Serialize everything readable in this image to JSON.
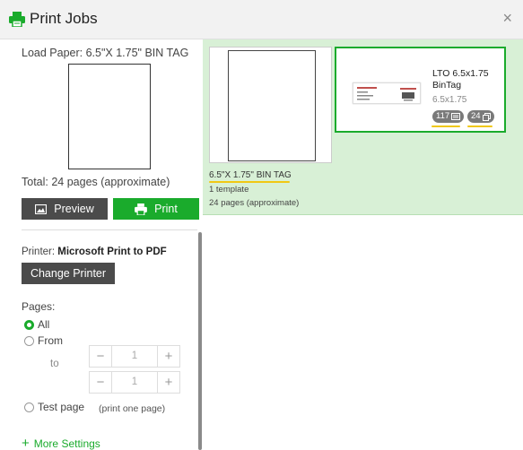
{
  "window": {
    "title": "Print Jobs",
    "close_glyph": "×"
  },
  "left_panel": {
    "load_paper": "Load Paper: 6.5\"X 1.75\" BIN TAG",
    "total": "Total: 24 pages (approximate)",
    "preview_label": "Preview",
    "print_label": "Print",
    "printer_prefix": "Printer: ",
    "printer_name": "Microsoft Print to PDF",
    "change_printer_label": "Change Printer",
    "pages_label": "Pages:",
    "option_all": "All",
    "option_from": "From",
    "to_label": "to",
    "from_value": "1",
    "to_value": "1",
    "minus_glyph": "−",
    "plus_glyph": "+",
    "test_page_label": "Test page",
    "test_page_hint": "(print one page)",
    "more_settings_label": "More Settings",
    "more_settings_glyph": "+",
    "selected_page_option": "All"
  },
  "right_panel": {
    "sheet": {
      "name": "6.5\"X 1.75\" BIN TAG",
      "templates": "1 template",
      "pages": "24 pages (approximate)"
    },
    "template_card": {
      "title": "LTO 6.5x1.75 BinTag",
      "size": "6.5x1.75",
      "records_count": "117",
      "pages_count": "24"
    }
  },
  "colors": {
    "accent_green": "#1aab2c",
    "selected_bg": "#d8f0d6",
    "dark_button": "#4b4b4b",
    "highlight_underline": "#f0c814"
  },
  "icons": [
    "printer-icon",
    "close-icon",
    "image-icon",
    "records-icon",
    "pages-icon"
  ]
}
